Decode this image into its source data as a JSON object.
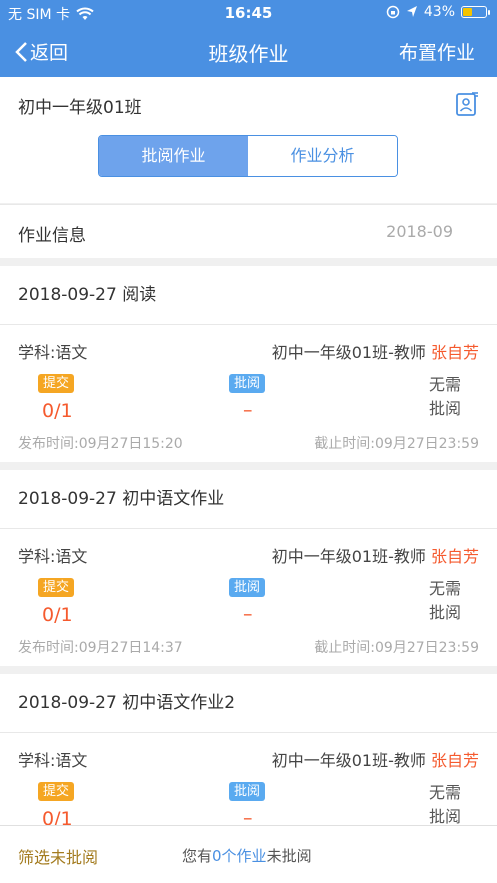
{
  "status_bar": {
    "carrier": "无 SIM 卡",
    "time": "16:45",
    "battery": "43%",
    "battery_level": 0.43
  },
  "nav": {
    "back_label": "返回",
    "title": "班级作业",
    "right_label": "布置作业"
  },
  "class_section": {
    "class_name": "初中一年级01班",
    "tabs": [
      {
        "label": "批阅作业",
        "active": true
      },
      {
        "label": "作业分析",
        "active": false
      }
    ]
  },
  "info_section": {
    "label": "作业信息",
    "date": "2018-09"
  },
  "assignments": [
    {
      "title": "2018-09-27 阅读",
      "subject": "学科:语文",
      "teacher_prefix": "初中一年级01班-教师",
      "teacher_name": "张自芳",
      "submit_badge": "提交",
      "submit_count": "0/1",
      "review_badge": "批阅",
      "review_value": "–",
      "status_line1": "无需",
      "status_line2": "批阅",
      "publish_time": "发布时间:09月27日15:20",
      "deadline": "截止时间:09月27日23:59"
    },
    {
      "title": "2018-09-27 初中语文作业",
      "subject": "学科:语文",
      "teacher_prefix": "初中一年级01班-教师",
      "teacher_name": "张自芳",
      "submit_badge": "提交",
      "submit_count": "0/1",
      "review_badge": "批阅",
      "review_value": "–",
      "status_line1": "无需",
      "status_line2": "批阅",
      "publish_time": "发布时间:09月27日14:37",
      "deadline": "截止时间:09月27日23:59"
    },
    {
      "title": "2018-09-27 初中语文作业2",
      "subject": "学科:语文",
      "teacher_prefix": "初中一年级01班-教师",
      "teacher_name": "张自芳",
      "submit_badge": "提交",
      "submit_count": "0/1",
      "review_badge": "批阅",
      "review_value": "–",
      "status_line1": "无需",
      "status_line2": "批阅"
    }
  ],
  "bottom_bar": {
    "filter_label": "筛选未批阅",
    "msg_prefix": "您有",
    "msg_highlight": "0个作业",
    "msg_suffix": "未批阅"
  },
  "colors": {
    "primary": "#4a90e2",
    "accent_red": "#f55a2e",
    "submit_orange": "#f5a623",
    "review_blue": "#5aaaf0"
  }
}
